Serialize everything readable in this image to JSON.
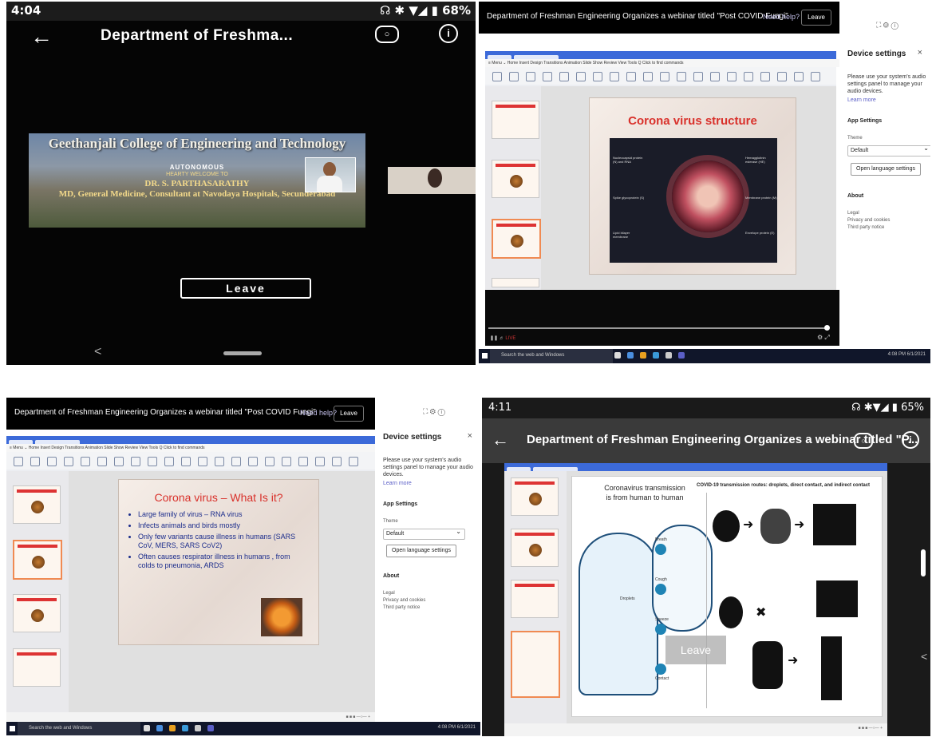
{
  "panel1": {
    "time": "4:04",
    "status_right": "☊ ✱ ▼◢ ▮ 68%",
    "back_glyph": "←",
    "title": "Department of Freshma...",
    "slide": {
      "college": "Geethanjali College of Engineering and Technology",
      "autonomous": "AUTONOMOUS",
      "welcome": "HEARTY WELCOME TO",
      "doctor": "DR. S. PARTHASARATHY",
      "designation": "MD, General Medicine, Consultant at Navodaya Hospitals, Secunderabad"
    },
    "leave_label": "Leave",
    "nav_back_glyph": "<"
  },
  "meeting_title": "Department of Freshman Engineering Organizes a webinar titled \"Post COVID Fungi\"",
  "need_help": "Need help?",
  "leave_label": "Leave",
  "settings": {
    "heading": "Device settings",
    "close": "×",
    "description": "Please use your system's audio settings panel to manage your audio devices.",
    "learn_more": "Learn more",
    "app_settings": "App Settings",
    "theme_label": "Theme",
    "theme_value": "Default",
    "open_language": "Open language settings",
    "about": "About",
    "legal": "Legal",
    "privacy": "Privacy and cookies",
    "third_party": "Third party notice"
  },
  "panel2": {
    "slide_title": "Corona virus structure",
    "labels": {
      "nucleocapsid": "Nucleocapsid protein (N) and RNA",
      "spike": "Spike glycoprotein (S)",
      "lipid": "Lipid bilayer membrane",
      "hemag": "Hemagglutinin esterase (HE)",
      "membrane": "Membrane protein (M)",
      "envelope": "Envelope protein (E)"
    },
    "live": "LIVE"
  },
  "panel3": {
    "slide_title": "Corona virus – What Is it?",
    "bullets": [
      "Large family of virus – RNA virus",
      "Infects  animals and birds mostly",
      "Only few variants cause illness in humans (SARS CoV, MERS, SARS CoV2)",
      "Often causes respirator illness in humans , from colds to pneumonia, ARDS"
    ]
  },
  "taskbar": {
    "search": "Search the web and Windows",
    "time": "4:08 PM",
    "date": "6/1/2021"
  },
  "panel4": {
    "time": "4:11",
    "status_right": "☊ ✱▼◢ ▮ 65%",
    "back_glyph": "←",
    "title": "Department of Freshman Engineering Organizes a webinar titled \"P...",
    "slide_left_title": "Coronavirus transmission is from human to human",
    "slide_right_title": "COVID-19 transmission routes: droplets, direct contact, and indirect contact",
    "labels": {
      "breath": "Breath",
      "droplets": "Droplets",
      "cough": "Cough",
      "sneeze": "Sneeze",
      "contact": "Contact"
    },
    "leave_overlay": "Leave",
    "chevron": "<"
  },
  "ribbon_menu": "≡ Menu ⌄  Home  Insert  Design  Transitions  Animation  Slide Show  Review  View  Tools  Q Click to find commands"
}
